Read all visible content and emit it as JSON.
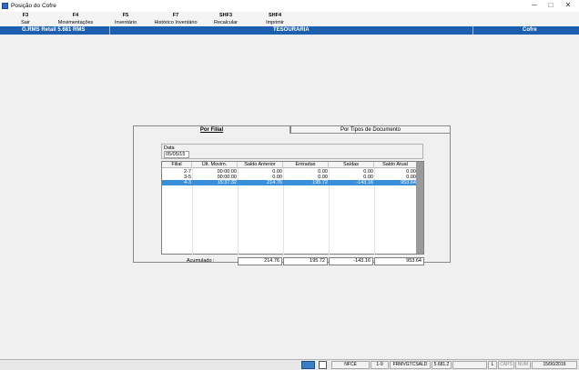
{
  "window": {
    "title": "Posição do Cofre",
    "min": "─",
    "max": "□",
    "close": "✕"
  },
  "toolbar": [
    {
      "key": "F3",
      "label": "Sair"
    },
    {
      "key": "F4",
      "label": "Movimentações"
    },
    {
      "key": "F5",
      "label": "Inventário"
    },
    {
      "key": "F7",
      "label": "Histórico Inventário"
    },
    {
      "key": "SHF3",
      "label": "Recalcular"
    },
    {
      "key": "SHF4",
      "label": "Imprimir"
    }
  ],
  "statusbar": {
    "product": "G.RMS Retail 5.681 RMS",
    "module": "TESOURARIA",
    "screen": "Cofre"
  },
  "tabs": [
    {
      "label": "Por Filial"
    },
    {
      "label": "Por Tipos de Documento"
    }
  ],
  "date": {
    "label": "Data",
    "value": "05/05/15"
  },
  "grid": {
    "headers": [
      "Filial",
      "Últ. Movim.",
      "Saldo Anterior",
      "Entradas",
      "Saídas",
      "Saldo Atual"
    ],
    "rows": [
      [
        "2-7",
        "00:00:00",
        "0.00",
        "0.00",
        "0.00",
        "0.00"
      ],
      [
        "3-5",
        "00:00:00",
        "0.00",
        "0.00",
        "0.00",
        "0.00"
      ],
      [
        "4-3",
        "15:37:32",
        "214.76",
        "195.72",
        "-143.16",
        "953.64"
      ]
    ]
  },
  "totals": {
    "label": "Acumulado :",
    "values": [
      "214.76",
      "195.72",
      "-143.16",
      "953.64"
    ]
  },
  "bottom": {
    "mode": "NFCE",
    "pos": "1-9",
    "program": "FRMVGTCSALD",
    "version": "5.681.2",
    "l": "L",
    "caps": "CAPS",
    "num": "NUM",
    "date": "15/06/2016"
  }
}
